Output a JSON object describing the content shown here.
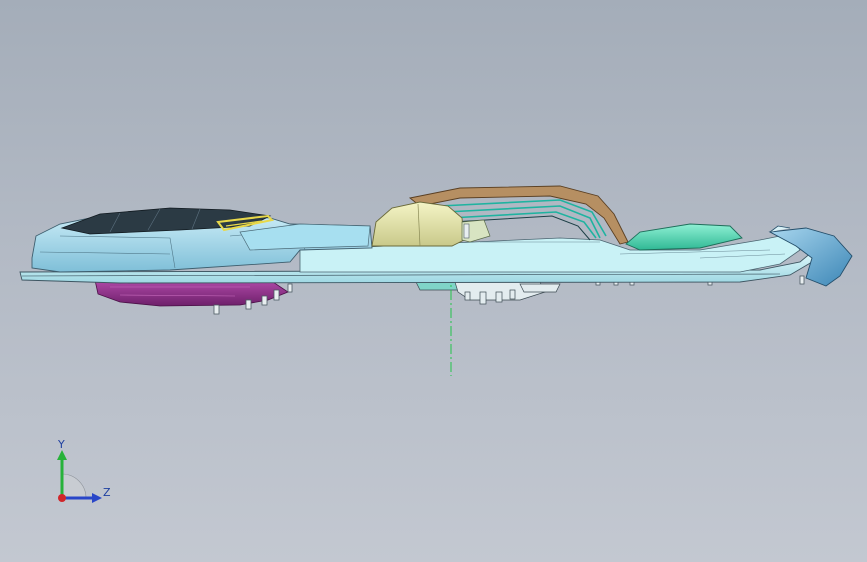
{
  "viewport": {
    "background_top": "#a4adb9",
    "background_bottom": "#c3c8d1"
  },
  "model": {
    "parts": [
      {
        "name": "base-plate",
        "color": "#bfeef3"
      },
      {
        "name": "left-dome-shell",
        "color": "#9fd6ea"
      },
      {
        "name": "dark-roof-panel",
        "color": "#2b3a44"
      },
      {
        "name": "yellow-trim",
        "color": "#e8d84a"
      },
      {
        "name": "magenta-underbody",
        "color": "#8a2f86"
      },
      {
        "name": "yellow-cushion",
        "color": "#e6e6a4"
      },
      {
        "name": "brown-arch",
        "color": "#9c7a55"
      },
      {
        "name": "green-pad",
        "color": "#48d0b0"
      },
      {
        "name": "blue-visor",
        "color": "#5aa2cc"
      }
    ],
    "center_axis_color": "#22c44a"
  },
  "triad": {
    "y_label": "Y",
    "z_label": "Z",
    "y_color": "#27b23a",
    "z_color": "#2946c8",
    "x_color": "#d0262a"
  }
}
